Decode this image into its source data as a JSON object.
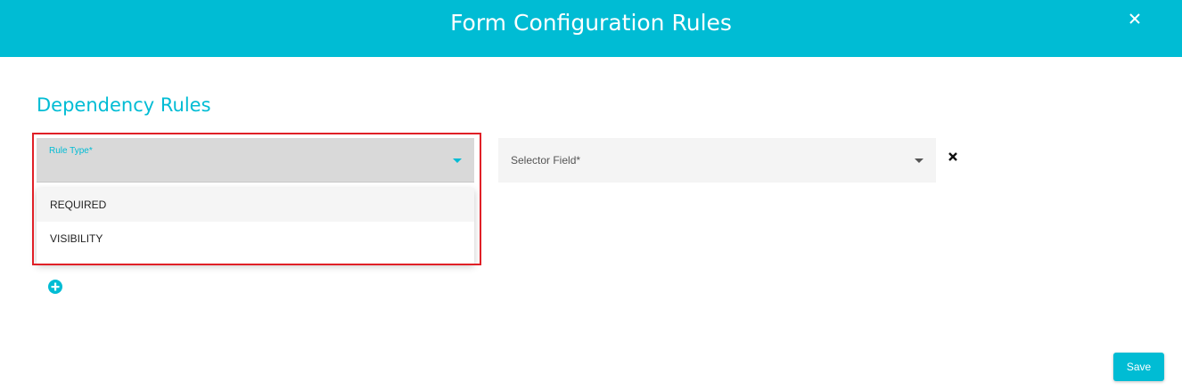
{
  "dialog": {
    "title": "Form Configuration Rules",
    "close_icon": "close-icon"
  },
  "section": {
    "title": "Dependency Rules"
  },
  "rule_type": {
    "label": "Rule Type*",
    "value": "",
    "arrow_icon": "caret-down-icon",
    "options": [
      "REQUIRED",
      "VISIBILITY"
    ]
  },
  "selector_field": {
    "placeholder": "Selector Field*",
    "value": "",
    "arrow_icon": "caret-down-icon"
  },
  "row_actions": {
    "remove_icon": "remove-x-icon"
  },
  "add_rule": {
    "icon": "add-circle-icon"
  },
  "footer": {
    "save_label": "Save"
  },
  "colors": {
    "accent": "#00bcd4",
    "highlight": "#e02027",
    "select_bg": "#d9d9d9",
    "field_bg": "#f4f4f4"
  }
}
